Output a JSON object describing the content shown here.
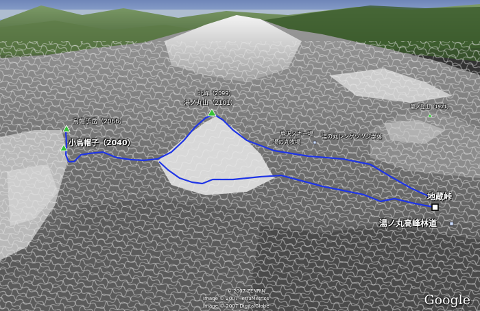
{
  "labels": {
    "eboshi": "烏帽子岳（2066）",
    "koeboshi": "小烏帽子（2040）",
    "kitamine": "北峰（2099）",
    "yunomaru": "湯ノ丸山（2101）",
    "kaminokura": "籠ノ登山（1921）",
    "ski": "鹿沢スキー場",
    "bokujo": "湯の丸牧場",
    "tsutsuji": "湯の丸レンゲツツジ群落",
    "jizo": "地蔵峠",
    "rindo": "湯ノ丸高峰林道"
  },
  "credits": {
    "line1": "© 2007 ZENRIN",
    "line2": "Image © 2007 TerraMetrics",
    "line3": "Image © 2007 DigitalGlobe"
  },
  "logo": "Google",
  "colors": {
    "route": "#1e34e6",
    "summit_marker": "#38c238",
    "sky": "#9fb8dc",
    "snow": "#e2e2e2",
    "rock": "#6a6a6a"
  }
}
